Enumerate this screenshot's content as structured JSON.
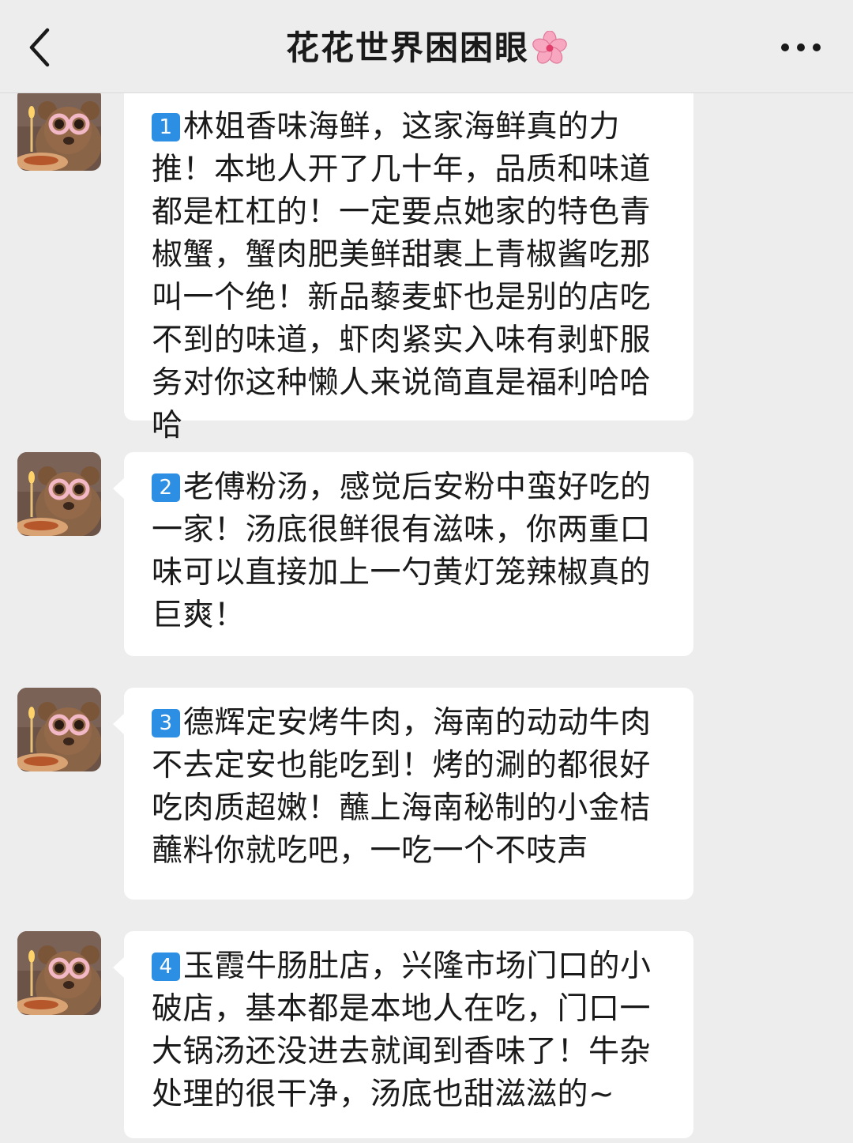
{
  "header": {
    "title": "花花世界困困眼",
    "title_emoji": "cherry-blossom-icon",
    "back_icon": "chevron-left-icon",
    "more_icon": "more-dots-icon"
  },
  "messages": [
    {
      "badge": "1",
      "text": "林姐香味海鲜，这家海鲜真的力推！本地人开了几十年，品质和味道都是杠杠的！一定要点她家的特色青椒蟹，蟹肉肥美鲜甜裹上青椒酱吃那叫一个绝！新品藜麦虾也是别的店吃不到的味道，虾肉紧实入味有剥虾服务对你这种懒人来说简直是福利哈哈哈"
    },
    {
      "badge": "2",
      "text": "老傅粉汤，感觉后安粉中蛮好吃的一家！汤底很鲜很有滋味，你两重口味可以直接加上一勺黄灯笼辣椒真的巨爽！"
    },
    {
      "badge": "3",
      "text": "德辉定安烤牛肉，海南的动动牛肉不去定安也能吃到！烤的涮的都很好吃肉质超嫩！蘸上海南秘制的小金桔蘸料你就吃吧，一吃一个不吱声"
    },
    {
      "badge": "4",
      "text": "玉霞牛肠肚店，兴隆市场门口的小破店，基本都是本地人在吃，门口一大锅汤还没进去就闻到香味了！牛杂处理的很干净，汤底也甜滋滋的~"
    }
  ],
  "colors": {
    "background": "#ededed",
    "bubble": "#ffffff",
    "badge": "#2d8fe3",
    "text": "#1a1a1a"
  }
}
